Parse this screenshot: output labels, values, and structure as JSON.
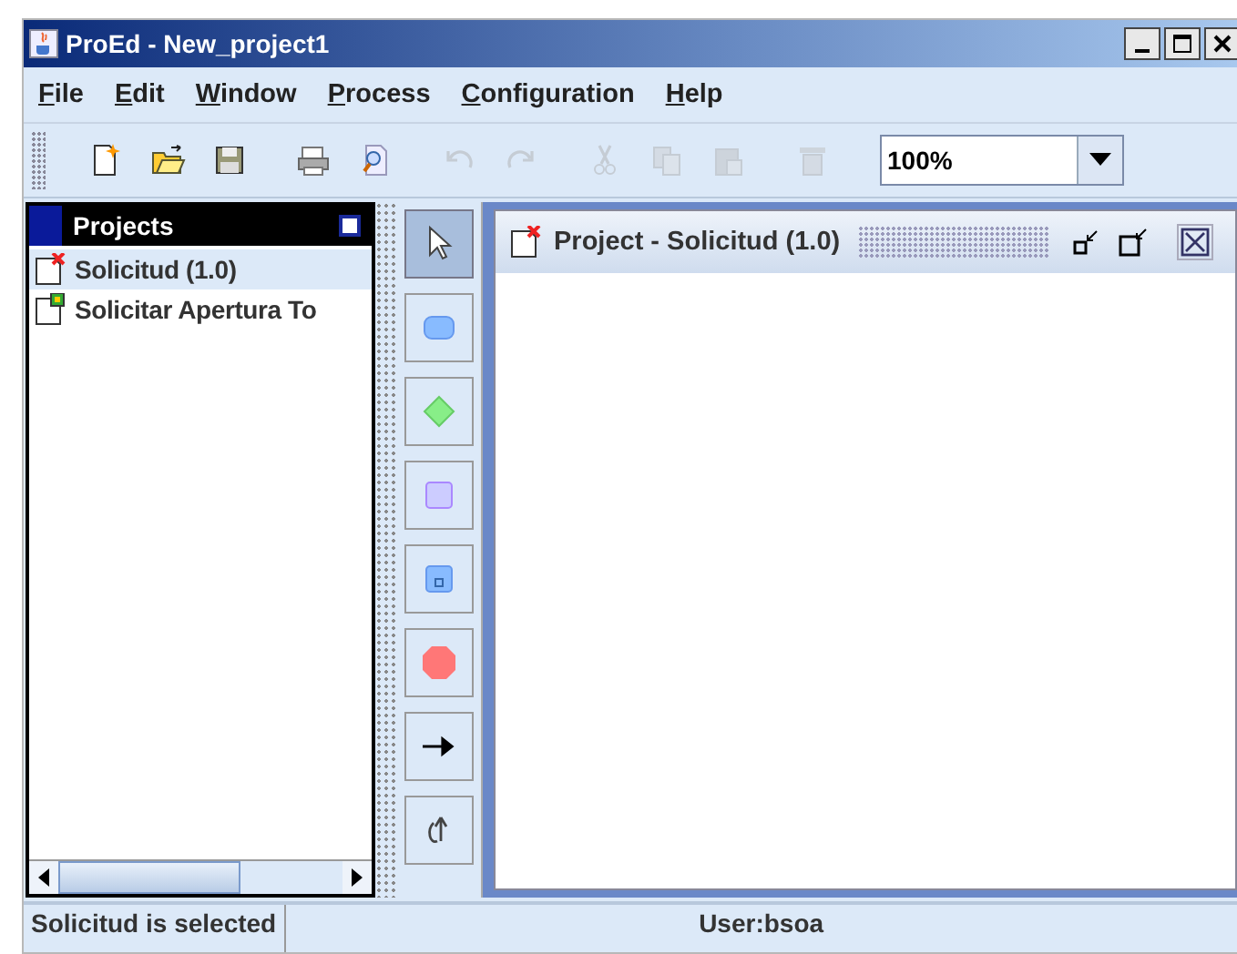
{
  "window": {
    "title": "ProEd - New_project1"
  },
  "menu": [
    "File",
    "Edit",
    "Window",
    "Process",
    "Configuration",
    "Help"
  ],
  "toolbar": [
    {
      "kind": "new",
      "disabled": false
    },
    {
      "kind": "open",
      "disabled": false
    },
    {
      "kind": "save",
      "disabled": false
    },
    {
      "kind": "print",
      "disabled": false
    },
    {
      "kind": "preview",
      "disabled": false
    },
    {
      "kind": "undo",
      "disabled": true
    },
    {
      "kind": "redo",
      "disabled": true
    },
    {
      "kind": "cut",
      "disabled": true
    },
    {
      "kind": "copy",
      "disabled": true
    },
    {
      "kind": "paste",
      "disabled": true
    },
    {
      "kind": "delete",
      "disabled": true
    }
  ],
  "zoom": {
    "value": "100%"
  },
  "projects": {
    "title": "Projects",
    "items": [
      {
        "label": "Solicitud (1.0)",
        "kind": "process",
        "selected": true
      },
      {
        "label": "Solicitar Apertura To",
        "kind": "diagram",
        "selected": false
      }
    ]
  },
  "palette": [
    {
      "kind": "pointer",
      "selected": true
    },
    {
      "kind": "task",
      "selected": false
    },
    {
      "kind": "decision",
      "selected": false
    },
    {
      "kind": "activity",
      "selected": false
    },
    {
      "kind": "subprocess",
      "selected": false
    },
    {
      "kind": "end",
      "selected": false
    },
    {
      "kind": "transition",
      "selected": false
    },
    {
      "kind": "loop",
      "selected": false
    }
  ],
  "frame": {
    "title": "Project - Solicitud (1.0)"
  },
  "status_bar": {
    "message": "Solicitud is selected",
    "user": "User:bsoa"
  }
}
